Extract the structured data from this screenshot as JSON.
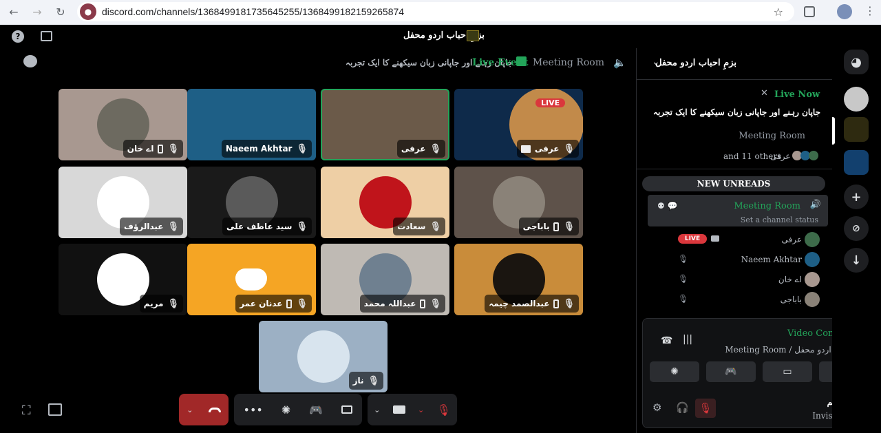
{
  "browser": {
    "url": "discord.com/channels/1368499181735645255/1368499182159265874",
    "back": "←",
    "forward": "→",
    "reload": "↻",
    "star": "☆"
  },
  "topbar": {
    "server_title": "بزمِ احباب اردو محفل",
    "help": "?"
  },
  "stage_header": {
    "room_name": "Meeting Room",
    "live_event": "Live Event",
    "topic": "جاپان رہنے اور جاپانی زبان سیکھنے کا ایک تجربہ"
  },
  "tiles": [
    {
      "name": "اے خان",
      "bg": "#a89890",
      "avatar": "#6d6a60",
      "phone": true,
      "screen": false
    },
    {
      "name": "Naeem Akhtar",
      "bg": "#1e5f86",
      "avatar": null,
      "phone": false,
      "screen": false
    },
    {
      "name": "عرفی",
      "bg": "#6b5a49",
      "avatar": null,
      "phone": false,
      "screen": false,
      "speaking": true
    },
    {
      "name": "عرفی",
      "bg": "#0e2a4a",
      "avatar": "#c28a4a",
      "phone": false,
      "screen": true,
      "live": "LIVE"
    },
    {
      "name": "عبدالرؤف",
      "bg": "#d8d8d8",
      "avatar": "#ffffff",
      "phone": false,
      "screen": false
    },
    {
      "name": "سید عاطف علی",
      "bg": "#1a1a1a",
      "avatar": "#5a5a5a",
      "phone": false,
      "screen": false
    },
    {
      "name": "سعادت",
      "bg": "#eecfa5",
      "avatar": "#c0141b",
      "phone": false,
      "screen": false
    },
    {
      "name": "باباجی",
      "bg": "#5e524a",
      "avatar": "#8a8278",
      "phone": true,
      "screen": false
    },
    {
      "name": "مریم",
      "bg": "#111111",
      "avatar": "#ffffff",
      "phone": false,
      "screen": false
    },
    {
      "name": "عدنان عمر",
      "bg": "#f5a524",
      "avatar": null,
      "phone": true,
      "screen": false
    },
    {
      "name": "عبداللہ محمد",
      "bg": "#bfbab4",
      "avatar": "#6f8090",
      "phone": true,
      "screen": false
    },
    {
      "name": "عبدالصمد چیمہ",
      "bg": "#c98c3a",
      "avatar": "#1a1510",
      "phone": true,
      "screen": false
    },
    {
      "name": "ناز",
      "bg": "#9cb0c4",
      "avatar": "#d8e4ee",
      "phone": false,
      "screen": false
    }
  ],
  "controls": {
    "more": "•••"
  },
  "sidebar": {
    "server_name": "بزمِ احباب اردو محفل",
    "event": {
      "live_now": "Live Now",
      "topic": "جاپان رہنے اور جاپانی زبان سیکھنے کا ایک تجربہ",
      "room": "Meeting Room",
      "others": "and 11 others",
      "host": "عرفی"
    },
    "new_unreads": "NEW UNREADS",
    "channel": {
      "name": "Meeting Room",
      "status": "Set a channel status"
    },
    "members": [
      {
        "name": "عرفی",
        "live": "LIVE",
        "avatar": "#3d6b4a"
      },
      {
        "name": "Naeem Akhtar",
        "avatar": "#1e5f86"
      },
      {
        "name": "اے خان",
        "avatar": "#a89890"
      },
      {
        "name": "باباجی",
        "avatar": "#8a8278"
      }
    ]
  },
  "voice_panel": {
    "connected": "Video Connected",
    "channel": "Meeting Room",
    "server": "بزمِ احباب اردو محفل",
    "user": "مریم",
    "user_status": "Invisible"
  },
  "rail": {
    "discord_icon": "discord-icon",
    "add": "+",
    "explore": "⊘",
    "download": "↓"
  }
}
